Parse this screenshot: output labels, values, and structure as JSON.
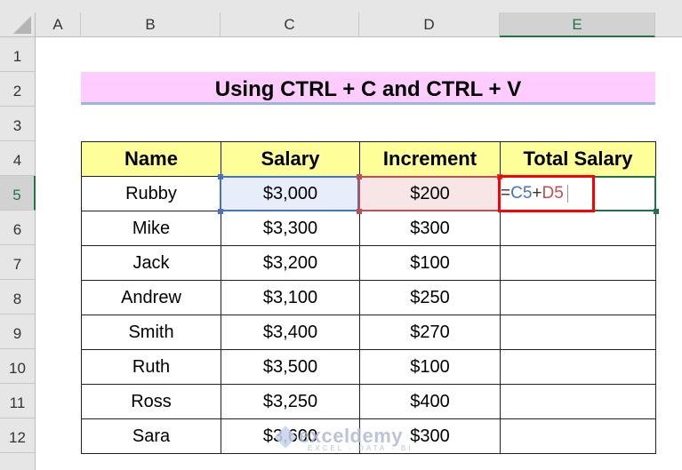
{
  "columns": [
    {
      "label": "A",
      "active": false
    },
    {
      "label": "B",
      "active": false
    },
    {
      "label": "C",
      "active": false
    },
    {
      "label": "D",
      "active": false
    },
    {
      "label": "E",
      "active": true
    }
  ],
  "rows": [
    "1",
    "2",
    "3",
    "4",
    "5",
    "6",
    "7",
    "8",
    "9",
    "10",
    "11",
    "12"
  ],
  "active_row": "5",
  "title": "Using CTRL + C and CTRL + V",
  "table": {
    "headers": [
      "Name",
      "Salary",
      "Increment",
      "Total Salary"
    ],
    "rows": [
      {
        "name": "Rubby",
        "salary": "$3,000",
        "increment": "$200",
        "total": ""
      },
      {
        "name": "Mike",
        "salary": "$3,300",
        "increment": "$300",
        "total": ""
      },
      {
        "name": "Jack",
        "salary": "$3,200",
        "increment": "$100",
        "total": ""
      },
      {
        "name": "Andrew",
        "salary": "$3,100",
        "increment": "$250",
        "total": ""
      },
      {
        "name": "Smith",
        "salary": "$3,400",
        "increment": "$270",
        "total": ""
      },
      {
        "name": "Ruth",
        "salary": "$3,500",
        "increment": "$100",
        "total": ""
      },
      {
        "name": "Ross",
        "salary": "$3,250",
        "increment": "$400",
        "total": ""
      },
      {
        "name": "Sara",
        "salary": "$3,600",
        "increment": "$300",
        "total": ""
      }
    ]
  },
  "editing_cell": {
    "ref": "E5",
    "formula_parts": {
      "eq": "=",
      "ref1": "C5",
      "op": "+",
      "ref2": "D5"
    }
  },
  "colors": {
    "ref1": "#4472c4",
    "ref2": "#c0504d",
    "active_cell": "#217346",
    "highlight_box": "#ff0000",
    "title_bg": "#ffccff",
    "header_bg": "#ffff99"
  },
  "watermark": {
    "logo": "exceldemy",
    "tagline": "EXCEL · DATA · BI"
  }
}
